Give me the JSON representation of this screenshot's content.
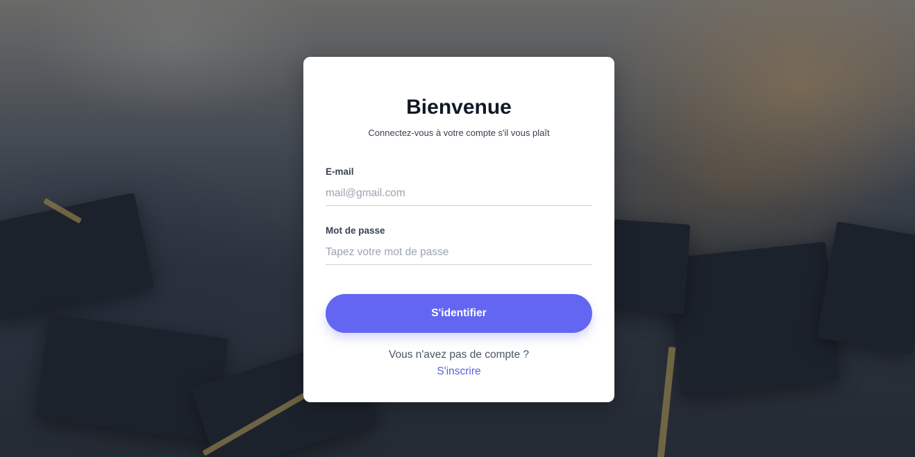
{
  "background": {
    "description_icon": "graduation-caps-photo"
  },
  "card": {
    "title": "Bienvenue",
    "subtitle": "Connectez-vous à votre compte s'il vous plaît",
    "email": {
      "label": "E-mail",
      "value": "",
      "placeholder": "mail@gmail.com"
    },
    "password": {
      "label": "Mot de passe",
      "value": "",
      "placeholder": "Tapez votre mot de passe"
    },
    "submit_label": "S'identifier",
    "no_account_text": "Vous n'avez pas de compte ?",
    "signup_link": "S'inscrire"
  },
  "colors": {
    "accent": "#6366f1",
    "link": "#5b5fd6",
    "title": "#111827"
  }
}
